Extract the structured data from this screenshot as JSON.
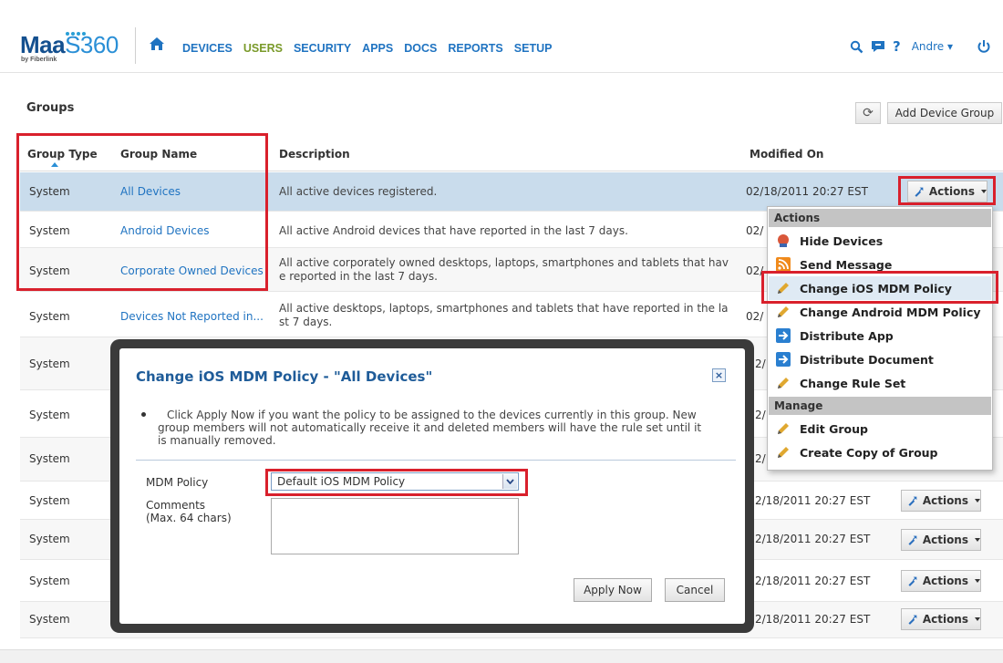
{
  "logo": {
    "brand_a": "Maa",
    "brand_b": "S360",
    "tagline": "by Fiberlink"
  },
  "nav": {
    "items": [
      "DEVICES",
      "USERS",
      "SECURITY",
      "APPS",
      "DOCS",
      "REPORTS",
      "SETUP"
    ],
    "active": "USERS"
  },
  "user_menu": {
    "name": "Andre",
    "help": "?"
  },
  "page": {
    "title": "Groups",
    "add_button": "Add Device Group"
  },
  "table": {
    "headers": {
      "type": "Group Type",
      "name": "Group Name",
      "description": "Description",
      "modified": "Modified On"
    },
    "actions_label": "Actions",
    "rows": [
      {
        "type": "System",
        "name": "All Devices",
        "desc1": "All active devices registered.",
        "desc2": "",
        "modified": "02/18/2011 20:27 EST"
      },
      {
        "type": "System",
        "name": "Android Devices",
        "desc1": "All active Android devices that have reported in the last 7 days.",
        "desc2": "",
        "modified": "02/"
      },
      {
        "type": "System",
        "name": "Corporate Owned Devices",
        "desc1": "All active corporately owned desktops, laptops, smartphones and tablets that hav",
        "desc2": "e reported in the last 7 days.",
        "modified": "02/"
      },
      {
        "type": "System",
        "name": "Devices Not Reported in...",
        "desc1": "All active desktops, laptops, smartphones and tablets that have reported in the la",
        "desc2": "st 7 days.",
        "modified": "02/"
      },
      {
        "type": "System",
        "name": "",
        "desc1": "",
        "desc2": "",
        "modified": "2/"
      },
      {
        "type": "System",
        "name": "",
        "desc1": "",
        "desc2": "",
        "modified": "2/"
      },
      {
        "type": "System",
        "name": "",
        "desc1": "",
        "desc2": "",
        "modified": "2/"
      },
      {
        "type": "System",
        "name": "",
        "desc1": "",
        "desc2": "",
        "modified": "2/18/2011 20:27 EST"
      },
      {
        "type": "System",
        "name": "",
        "desc1": "",
        "desc2": "",
        "modified": "2/18/2011 20:27 EST"
      },
      {
        "type": "System",
        "name": "",
        "desc1": "",
        "desc2": "",
        "modified": "2/18/2011 20:27 EST"
      },
      {
        "type": "System",
        "name": "",
        "desc1": "",
        "desc2": "",
        "modified": "2/18/2011 20:27 EST"
      }
    ]
  },
  "menu": {
    "sections": [
      "Actions",
      "Manage"
    ],
    "items": [
      {
        "label": "Hide Devices",
        "icon": "hide-devices-icon"
      },
      {
        "label": "Send Message",
        "icon": "rss-message-icon"
      },
      {
        "label": "Change iOS MDM Policy",
        "icon": "pencil-icon"
      },
      {
        "label": "Change Android MDM Policy",
        "icon": "pencil-icon"
      },
      {
        "label": "Distribute App",
        "icon": "distribute-arrow-icon"
      },
      {
        "label": "Distribute Document",
        "icon": "distribute-arrow-icon"
      },
      {
        "label": "Change Rule Set",
        "icon": "pencil-icon"
      },
      {
        "label": "Edit Group",
        "icon": "pencil-icon"
      },
      {
        "label": "Create Copy of Group",
        "icon": "pencil-icon"
      }
    ]
  },
  "dialog": {
    "title": "Change iOS MDM Policy - \"All Devices\"",
    "close": "×",
    "message_line1": "Click Apply Now if you want the policy to be assigned to the devices currently in this group. New",
    "message_line2": "group members will not automatically receive it and deleted members will have the rule set until it",
    "message_line3": "is manually removed.",
    "policy_label": "MDM Policy",
    "policy_value": "Default iOS MDM Policy",
    "comments_label": "Comments",
    "comments_hint": "(Max. 64 chars)",
    "apply_button": "Apply Now",
    "cancel_button": "Cancel"
  },
  "colors": {
    "link": "#1f73c1",
    "active_nav": "#7a9a2a",
    "highlight": "#d9202c",
    "selected_row": "#c9dcec"
  }
}
